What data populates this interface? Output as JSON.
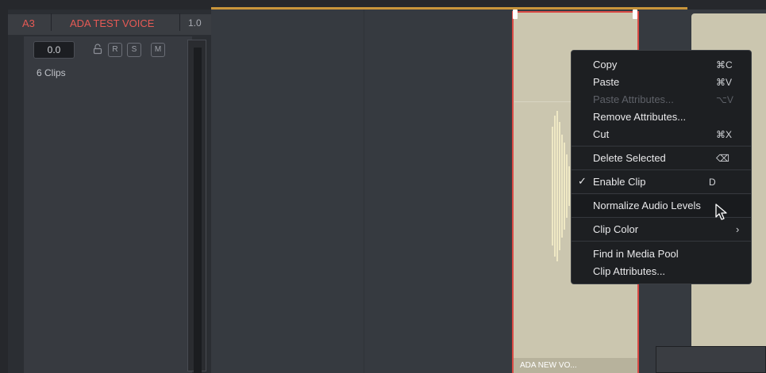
{
  "track": {
    "id": "A3",
    "name": "ADA TEST VOICE",
    "level": "1.0",
    "volume": "0.0",
    "buttons": {
      "record": "R",
      "solo": "S",
      "mute": "M"
    },
    "clip_count": "6 Clips"
  },
  "timeline": {
    "clip_label": "ADA NEW VO..."
  },
  "context_menu": {
    "items": [
      {
        "label": "Copy",
        "shortcut": "⌘C"
      },
      {
        "label": "Paste",
        "shortcut": "⌘V"
      },
      {
        "label": "Paste Attributes...",
        "shortcut": "⌥V",
        "disabled": true
      },
      {
        "label": "Remove Attributes..."
      },
      {
        "label": "Cut",
        "shortcut": "⌘X"
      },
      {
        "label": "Delete Selected",
        "shortcut": "⌫"
      },
      {
        "label": "Enable Clip",
        "shortcut": "D",
        "checked": true
      },
      {
        "label": "Normalize Audio Levels",
        "highlighted": true
      },
      {
        "label": "Clip Color",
        "submenu": true
      },
      {
        "label": "Find in Media Pool"
      },
      {
        "label": "Clip Attributes..."
      }
    ]
  },
  "colors": {
    "track_accent": "#e65a55",
    "playhead": "#c9953b",
    "clip_fill": "#cbc6af",
    "selected_clip_border": "#d94a45"
  },
  "icons": [
    "lock-icon",
    "check-icon",
    "submenu-arrow-icon",
    "pointer-cursor-icon",
    "waveform-icon"
  ]
}
